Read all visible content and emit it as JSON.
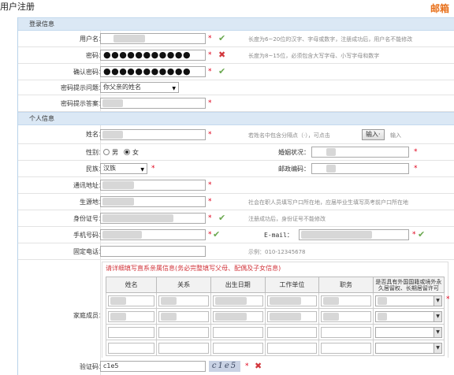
{
  "page": {
    "title": "用户注册",
    "logo": "邮箱"
  },
  "login_section": {
    "title": "登录信息",
    "username": {
      "label": "用户名：",
      "hint": "长度为6~20位的汉字、字母或数字，注册成功后，用户名不能修改"
    },
    "password": {
      "label": "密码：",
      "value": "●●●●●●●●●●●",
      "hint": "长度为8~15位，必须包含大写字母、小写字母和数字"
    },
    "confirm_password": {
      "label": "确认密码：",
      "value": "●●●●●●●●●●●"
    },
    "question": {
      "label": "密码提示问题：",
      "value": "你父亲的姓名"
    },
    "answer": {
      "label": "密码提示答案："
    }
  },
  "personal_section": {
    "title": "个人信息",
    "name": {
      "label": "姓名：",
      "hint": "若姓名中包含分隔点（·），可点击",
      "button": "输入·",
      "hint_tail": "输入"
    },
    "gender": {
      "label": "性别：",
      "male": "男",
      "female": "女",
      "selected": "女"
    },
    "marital": {
      "label": "婚姻状况："
    },
    "ethnicity": {
      "label": "民族：",
      "value": "汉族"
    },
    "postcode": {
      "label": "邮政编码："
    },
    "address": {
      "label": "通讯地址："
    },
    "origin": {
      "label": "生源地：",
      "hint": "社会在职人员填写户口所在地，应届毕业生填写高考前户口所在地"
    },
    "id_number": {
      "label": "身份证号：",
      "hint": "注册成功后，身份证号不能修改"
    },
    "mobile": {
      "label": "手机号码："
    },
    "email": {
      "label": "E-mail："
    },
    "phone": {
      "label": "固定电话：",
      "hint": "示例：010-12345678"
    }
  },
  "family": {
    "label": "家庭成员：",
    "notice": "请详细填写直系亲属信息(务必完整填写父母、配偶及子女信息)",
    "columns": [
      "姓名",
      "关系",
      "出生日期",
      "工作单位",
      "职务",
      "是否具有外国国籍或境外永久居留权、长期居留许可"
    ]
  },
  "captcha": {
    "label": "验证码：",
    "value": "c1e5",
    "image_text": "c1e5"
  }
}
